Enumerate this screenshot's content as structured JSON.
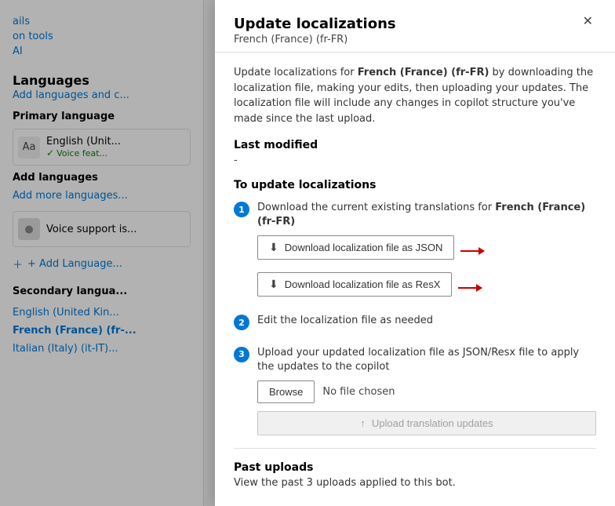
{
  "background": {
    "nav_links": [
      "ails",
      "on tools",
      "AI"
    ],
    "languages_title": "Languages",
    "languages_subtitle": "Add languages and c...",
    "primary_section": "Primary language",
    "primary_lang_name": "English (Unit...",
    "primary_lang_status": "Voice feat...",
    "add_languages_title": "Add languages",
    "add_languages_subtitle": "Add more languages...",
    "voice_support_text": "Voice support is...",
    "add_language_btn": "+ Add Language...",
    "secondary_section": "Secondary langua...",
    "secondary_langs": [
      {
        "name": "English (United Kin...",
        "active": false
      },
      {
        "name": "French (France) (fr-...",
        "active": true
      },
      {
        "name": "Italian (Italy) (it-IT)...",
        "active": false
      }
    ]
  },
  "dialog": {
    "title": "Update localizations",
    "subtitle": "French (France) (fr-FR)",
    "close_label": "✕",
    "description": "Update localizations for French (France) (fr-FR) by downloading the localization file, making your edits, then uploading your updates. The localization file will include any changes in copilot structure you've made since the last upload.",
    "description_bold": "French (France) (fr-FR)",
    "last_modified_label": "Last modified",
    "last_modified_value": "-",
    "to_update_title": "To update localizations",
    "step1_text": "Download the current existing translations for French (France) (fr-FR)",
    "step1_bold": "French (France) (fr-FR)",
    "download_json_label": "Download localization file as JSON",
    "download_resx_label": "Download localization file as ResX",
    "step2_text": "Edit the localization file as needed",
    "step3_text": "Upload your updated localization file as JSON/Resx file to apply the updates to the copilot",
    "browse_label": "Browse",
    "no_file_label": "No file chosen",
    "upload_label": "Upload translation updates",
    "upload_icon": "↑",
    "past_uploads_title": "Past uploads",
    "past_uploads_text": "View the past 3 uploads applied to this bot."
  }
}
